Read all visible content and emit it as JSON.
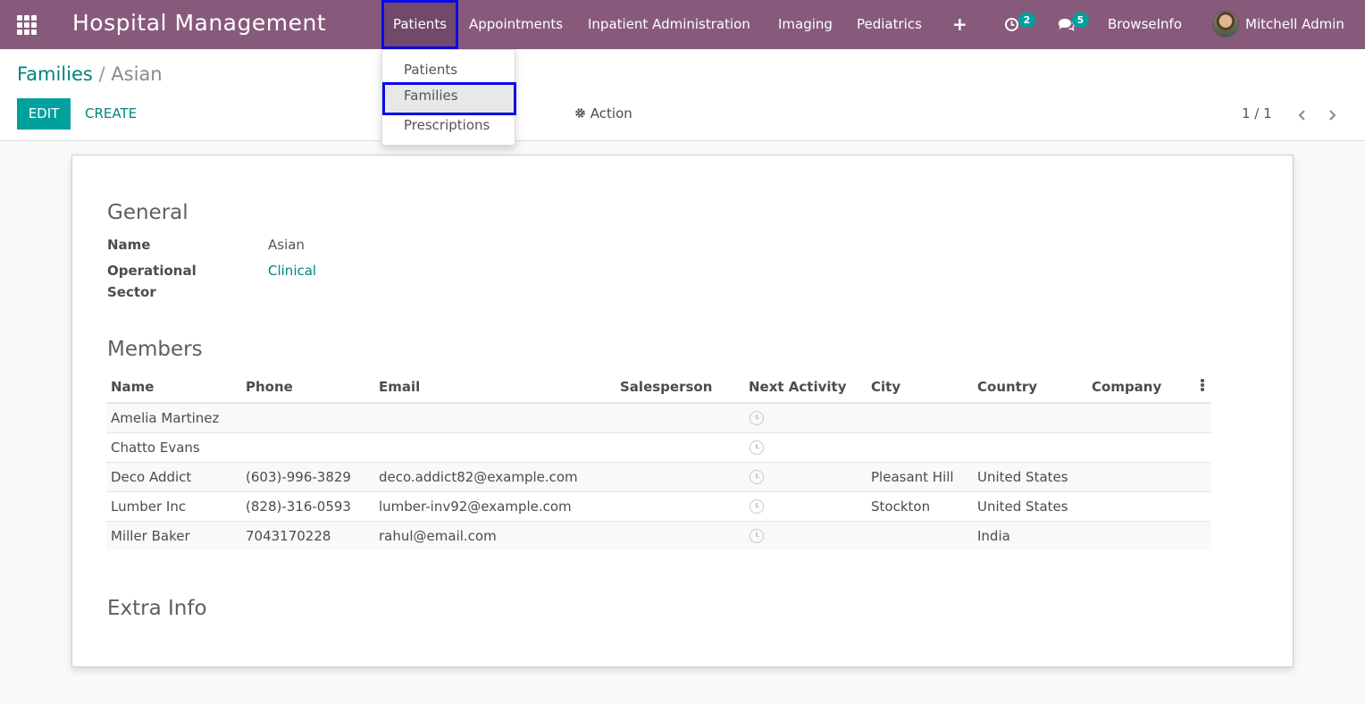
{
  "navbar": {
    "brand": "Hospital Management",
    "menu": [
      {
        "label": "Patients",
        "active": true
      },
      {
        "label": "Appointments"
      },
      {
        "label": "Inpatient Administration"
      },
      {
        "label": "Imaging"
      },
      {
        "label": "Pediatrics"
      }
    ],
    "add_icon": "plus-icon",
    "activity_count": "2",
    "message_count": "5",
    "company": "BrowseInfo",
    "user": "Mitchell Admin"
  },
  "dropdown": {
    "items": [
      {
        "label": "Patients"
      },
      {
        "label": "Families",
        "highlighted": true
      },
      {
        "label": "Prescriptions"
      }
    ]
  },
  "breadcrumb": {
    "parent": "Families",
    "separator": "/",
    "current": "Asian"
  },
  "buttons": {
    "edit": "EDIT",
    "create": "CREATE",
    "action": "Action"
  },
  "pager": {
    "value": "1 / 1"
  },
  "form": {
    "general_title": "General",
    "name_label": "Name",
    "name_value": "Asian",
    "sector_label_1": "Operational",
    "sector_label_2": "Sector",
    "sector_value": "Clinical",
    "members_title": "Members",
    "extra_title": "Extra Info"
  },
  "members": {
    "columns": [
      "Name",
      "Phone",
      "Email",
      "Salesperson",
      "Next Activity",
      "City",
      "Country",
      "Company"
    ],
    "rows": [
      {
        "name": "Amelia Martinez",
        "phone": "",
        "email": "",
        "salesperson": "",
        "city": "",
        "country": "",
        "company": ""
      },
      {
        "name": "Chatto Evans",
        "phone": "",
        "email": "",
        "salesperson": "",
        "city": "",
        "country": "",
        "company": ""
      },
      {
        "name": "Deco Addict",
        "phone": "(603)-996-3829",
        "email": "deco.addict82@example.com",
        "salesperson": "",
        "city": "Pleasant Hill",
        "country": "United States",
        "company": ""
      },
      {
        "name": "Lumber Inc",
        "phone": "(828)-316-0593",
        "email": "lumber-inv92@example.com",
        "salesperson": "",
        "city": "Stockton",
        "country": "United States",
        "company": ""
      },
      {
        "name": "Miller Baker",
        "phone": "7043170228",
        "email": "rahul@email.com",
        "salesperson": "",
        "city": "",
        "country": "India",
        "company": ""
      }
    ]
  },
  "colors": {
    "navbar": "#875a7b",
    "accent": "#00a09d",
    "link": "#01847f",
    "highlight_border": "#0a0ae6"
  }
}
